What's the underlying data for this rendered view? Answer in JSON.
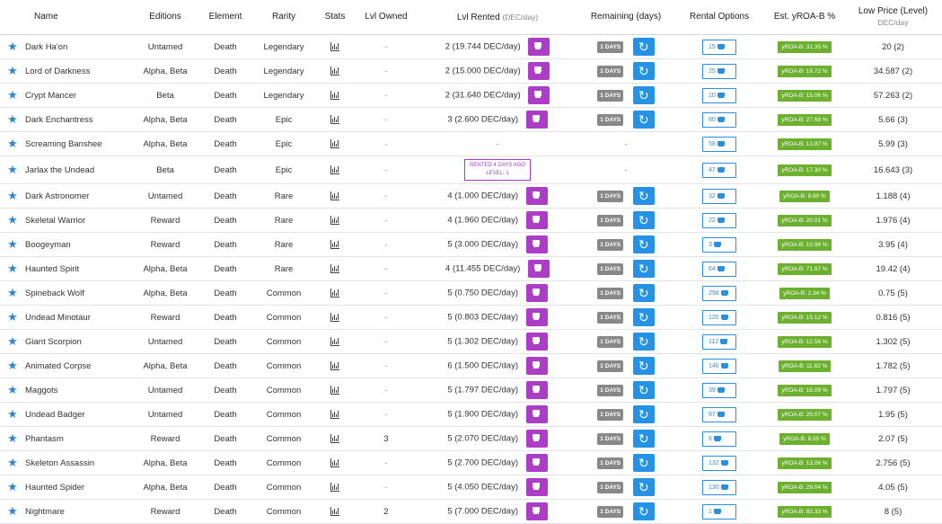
{
  "headers": {
    "name": "Name",
    "editions": "Editions",
    "element": "Element",
    "rarity": "Rarity",
    "stats": "Stats",
    "lvl_owned": "Lvl Owned",
    "lvl_rented": "Lvl Rented",
    "lvl_rented_unit": "(DEC/day)",
    "remaining": "Remaining (days)",
    "rental_options": "Rental Options",
    "yroa": "Est. yROA-B %",
    "low_price": "Low Price (Level)",
    "low_price_unit": "DEC/day"
  },
  "rows": [
    {
      "name": "Dark Ha'on",
      "editions": "Untamed",
      "element": "Death",
      "rarity": "Legendary",
      "lvl_owned": "-",
      "rented": "2 (19.744 DEC/day)",
      "days": "1 DAYS",
      "options": "15",
      "yroa": "yROA-B: 31.35 %",
      "low": "20 (2)"
    },
    {
      "name": "Lord of Darkness",
      "editions": "Alpha, Beta",
      "element": "Death",
      "rarity": "Legendary",
      "lvl_owned": "-",
      "rented": "2 (15.000 DEC/day)",
      "days": "1 DAYS",
      "options": "25",
      "yroa": "yROA-B: 19.72 %",
      "low": "34.587 (2)"
    },
    {
      "name": "Crypt Mancer",
      "editions": "Beta",
      "element": "Death",
      "rarity": "Legendary",
      "lvl_owned": "-",
      "rented": "2 (31.640 DEC/day)",
      "days": "1 DAYS",
      "options": "10",
      "yroa": "yROA-B: 15.06 %",
      "low": "57.263 (2)"
    },
    {
      "name": "Dark Enchantress",
      "editions": "Alpha, Beta",
      "element": "Death",
      "rarity": "Epic",
      "lvl_owned": "-",
      "rented": "3 (2.600 DEC/day)",
      "days": "1 DAYS",
      "options": "80",
      "yroa": "yROA-B: 27.68 %",
      "low": "5.66 (3)"
    },
    {
      "name": "Screaming Banshee",
      "editions": "Alpha, Beta",
      "element": "Death",
      "rarity": "Epic",
      "lvl_owned": "-",
      "rented": "-",
      "days": "",
      "options": "58",
      "yroa": "yROA-B: 13.87 %",
      "low": "5.99 (3)"
    },
    {
      "name": "Jarlax the Undead",
      "editions": "Beta",
      "element": "Death",
      "rarity": "Epic",
      "lvl_owned": "-",
      "rented": "",
      "rented_box_1": "RENTED 4 DAYS AGO",
      "rented_box_2": "LEVEL: 1",
      "days": "",
      "options": "47",
      "yroa": "yROA-B: 17.30 %",
      "low": "16.643 (3)"
    },
    {
      "name": "Dark Astronomer",
      "editions": "Untamed",
      "element": "Death",
      "rarity": "Rare",
      "lvl_owned": "-",
      "rented": "4 (1.000 DEC/day)",
      "days": "1 DAYS",
      "options": "32",
      "yroa": "yROA-B: 8.80 %",
      "low": "1.188 (4)"
    },
    {
      "name": "Skeletal Warrior",
      "editions": "Reward",
      "element": "Death",
      "rarity": "Rare",
      "lvl_owned": "-",
      "rented": "4 (1.960 DEC/day)",
      "days": "1 DAYS",
      "options": "22",
      "yroa": "yROA-B: 20.01 %",
      "low": "1.976 (4)"
    },
    {
      "name": "Boogeyman",
      "editions": "Reward",
      "element": "Death",
      "rarity": "Rare",
      "lvl_owned": "-",
      "rented": "5 (3.000 DEC/day)",
      "days": "1 DAYS",
      "options": "3",
      "yroa": "yROA-B: 10.98 %",
      "low": "3.95 (4)"
    },
    {
      "name": "Haunted Spirit",
      "editions": "Alpha, Beta",
      "element": "Death",
      "rarity": "Rare",
      "lvl_owned": "-",
      "rented": "4 (11.455 DEC/day)",
      "days": "1 DAYS",
      "options": "64",
      "yroa": "yROA-B: 71.67 %",
      "low": "19.42 (4)"
    },
    {
      "name": "Spineback Wolf",
      "editions": "Alpha, Beta",
      "element": "Death",
      "rarity": "Common",
      "lvl_owned": "-",
      "rented": "5 (0.750 DEC/day)",
      "days": "1 DAYS",
      "options": "298",
      "yroa": "yROA-B: 2.34 %",
      "low": "0.75 (5)"
    },
    {
      "name": "Undead Minotaur",
      "editions": "Reward",
      "element": "Death",
      "rarity": "Common",
      "lvl_owned": "-",
      "rented": "5 (0.803 DEC/day)",
      "days": "1 DAYS",
      "options": "120",
      "yroa": "yROA-B: 15.12 %",
      "low": "0.816 (5)"
    },
    {
      "name": "Giant Scorpion",
      "editions": "Untamed",
      "element": "Death",
      "rarity": "Common",
      "lvl_owned": "-",
      "rented": "5 (1.302 DEC/day)",
      "days": "1 DAYS",
      "options": "112",
      "yroa": "yROA-B: 12.56 %",
      "low": "1.302 (5)"
    },
    {
      "name": "Animated Corpse",
      "editions": "Alpha, Beta",
      "element": "Death",
      "rarity": "Common",
      "lvl_owned": "-",
      "rented": "6 (1.500 DEC/day)",
      "days": "1 DAYS",
      "options": "146",
      "yroa": "yROA-B: 11.62 %",
      "low": "1.782 (5)"
    },
    {
      "name": "Maggots",
      "editions": "Untamed",
      "element": "Death",
      "rarity": "Common",
      "lvl_owned": "-",
      "rented": "5 (1.797 DEC/day)",
      "days": "1 DAYS",
      "options": "39",
      "yroa": "yROA-B: 18.09 %",
      "low": "1.797 (5)"
    },
    {
      "name": "Undead Badger",
      "editions": "Untamed",
      "element": "Death",
      "rarity": "Common",
      "lvl_owned": "-",
      "rented": "5 (1.900 DEC/day)",
      "days": "1 DAYS",
      "options": "97",
      "yroa": "yROA-B: 20.07 %",
      "low": "1.95 (5)"
    },
    {
      "name": "Phantasm",
      "editions": "Reward",
      "element": "Death",
      "rarity": "Common",
      "lvl_owned": "3",
      "rented": "5 (2.070 DEC/day)",
      "days": "1 DAYS",
      "options": "6",
      "yroa": "yROA-B: 8.55 %",
      "low": "2.07 (5)"
    },
    {
      "name": "Skeleton Assassin",
      "editions": "Alpha, Beta",
      "element": "Death",
      "rarity": "Common",
      "lvl_owned": "-",
      "rented": "5 (2.700 DEC/day)",
      "days": "1 DAYS",
      "options": "132",
      "yroa": "yROA-B: 13.06 %",
      "low": "2.756 (5)"
    },
    {
      "name": "Haunted Spider",
      "editions": "Alpha, Beta",
      "element": "Death",
      "rarity": "Common",
      "lvl_owned": "-",
      "rented": "5 (4.050 DEC/day)",
      "days": "1 DAYS",
      "options": "130",
      "yroa": "yROA-B: 29.04 %",
      "low": "4.05 (5)"
    },
    {
      "name": "Nightmare",
      "editions": "Reward",
      "element": "Death",
      "rarity": "Common",
      "lvl_owned": "2",
      "rented": "5 (7.000 DEC/day)",
      "days": "1 DAYS",
      "options": "1",
      "yroa": "yROA-B: 82.33 %",
      "low": "8 (5)"
    }
  ],
  "colors": {
    "star": "#2f86d6",
    "rent_button": "#ab3dc7",
    "days_badge": "#888888",
    "refresh_button": "#2592e6",
    "option_border": "#2a8fe0",
    "yroa_badge": "#6bb02f"
  },
  "icons": {
    "favorite": "star-icon",
    "stats": "bar-chart-icon",
    "rent": "layers-icon",
    "refresh": "refresh-icon"
  }
}
